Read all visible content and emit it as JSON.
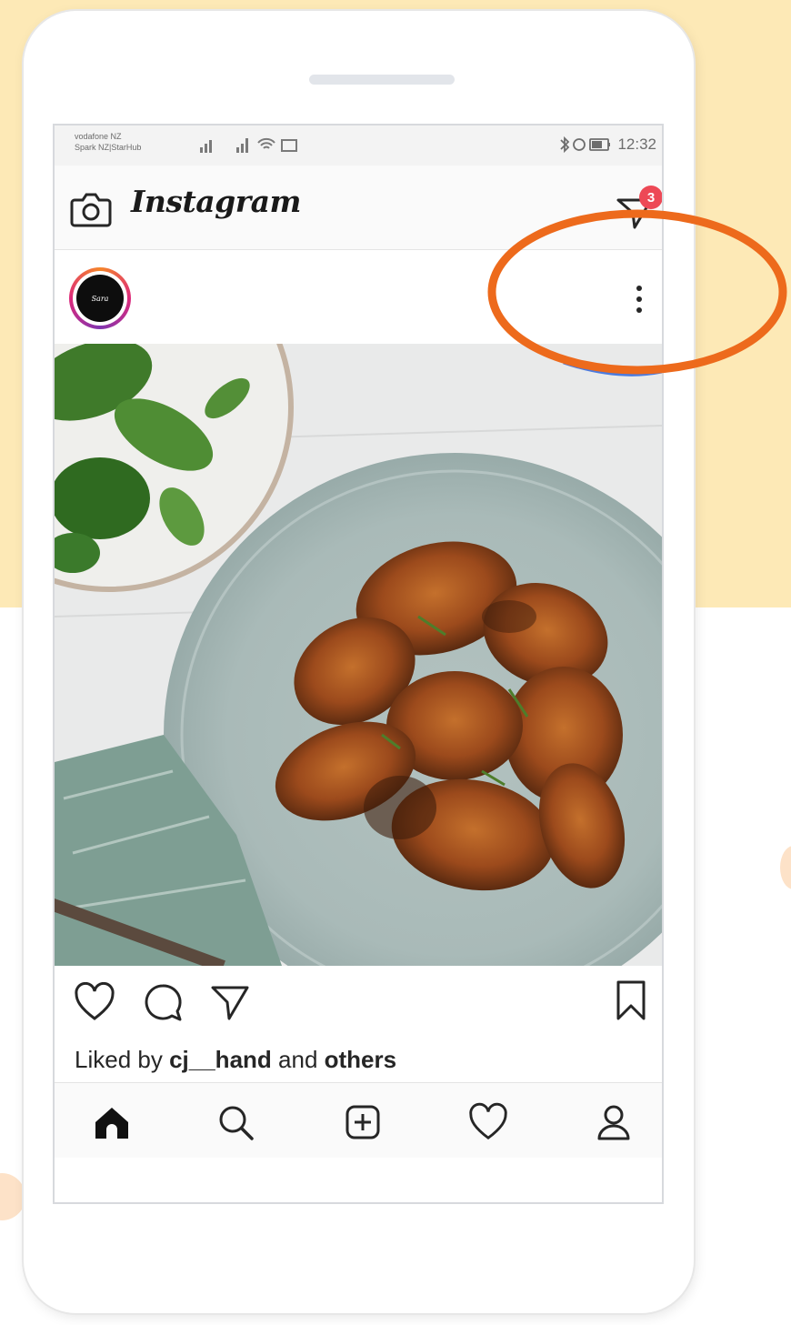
{
  "status_bar": {
    "carrier_line1": "vodafone NZ",
    "carrier_line2": "Spark NZ|StarHub",
    "time": "12:32"
  },
  "header": {
    "brand": "Instagram",
    "dm_badge_count": "3",
    "icons": [
      "camera-icon",
      "direct-message-icon"
    ]
  },
  "post": {
    "avatar_text": "Sara",
    "more_icon": "more-vertical-icon",
    "likes": {
      "prefix": "Liked by ",
      "user": "cj__hand",
      "middle": " and ",
      "suffix": "others"
    },
    "actions": [
      "heart-icon",
      "comment-icon",
      "share-icon",
      "bookmark-icon"
    ]
  },
  "bottom_nav": [
    "home-icon",
    "search-icon",
    "add-post-icon",
    "activity-heart-icon",
    "profile-icon"
  ],
  "colors": {
    "background_top": "#fde9b6",
    "highlight_ring": "#ed6a1c",
    "badge": "#ed4956"
  }
}
